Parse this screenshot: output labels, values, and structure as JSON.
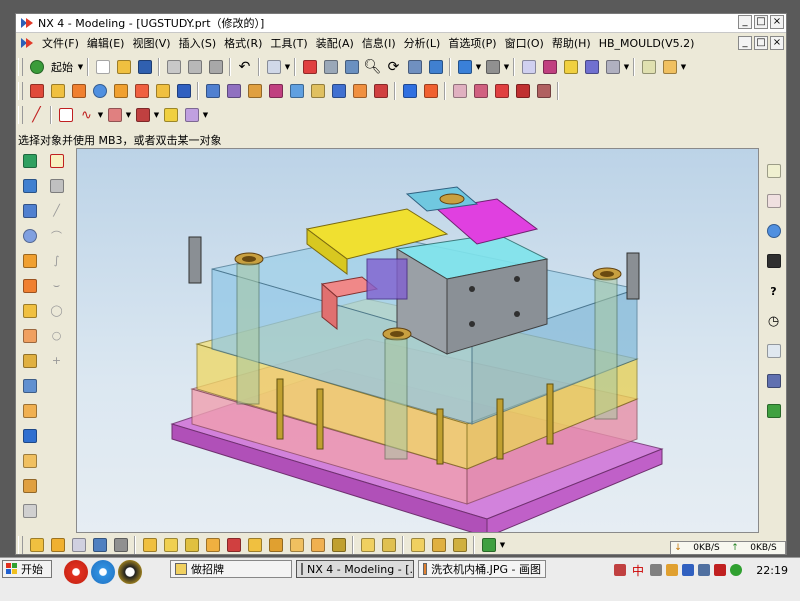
{
  "window": {
    "title": "NX 4 - Modeling - [UGSTUDY.prt（修改的）]",
    "min_label": "_",
    "max_label": "□",
    "close_label": "×"
  },
  "menu": {
    "items": [
      "文件(F)",
      "编辑(E)",
      "视图(V)",
      "插入(S)",
      "格式(R)",
      "工具(T)",
      "装配(A)",
      "信息(I)",
      "分析(L)",
      "首选项(P)",
      "窗口(O)",
      "帮助(H)",
      "HB_MOULD(V5.2)"
    ]
  },
  "toolbar1": {
    "start_label": "起始",
    "icons": [
      "new-icon",
      "open-icon",
      "save-icon",
      "cut-icon",
      "copy-icon",
      "paste-icon",
      "undo-icon",
      "selection-icon",
      "fit-icon",
      "zoom-window-icon",
      "zoom-icon",
      "rotate-icon",
      "pan-icon",
      "refresh-icon",
      "shaded-icon",
      "wireframe-icon",
      "wcs-icon",
      "datum-icon",
      "snap-icon",
      "filter-icon",
      "layer-icon",
      "measure-icon"
    ]
  },
  "toolbar2": {
    "icons": [
      "block-icon",
      "cylinder-icon",
      "cone-icon",
      "sphere-icon",
      "extrude-icon",
      "revolve-icon",
      "sweep-icon",
      "hole-icon",
      "boss-icon",
      "pocket-icon",
      "pad-icon",
      "slot-icon",
      "groove-icon",
      "thread-icon",
      "blend-icon",
      "chamfer-icon",
      "shell-icon",
      "draft-icon",
      "trim-icon",
      "split-icon",
      "offset-icon",
      "curve-icon",
      "spline-icon",
      "mirror-icon"
    ]
  },
  "toolbar3": {
    "icons": [
      "line-icon",
      "arc-icon",
      "point-icon",
      "plane-icon",
      "axis-icon",
      "sketch-icon",
      "project-icon",
      "intersect-icon",
      "bridge-icon",
      "fillet-curve-icon"
    ]
  },
  "status": {
    "prompt": "选择对象并使用 MB3，或者双击某一对象"
  },
  "netmon": {
    "down": "0KB/S",
    "up": "0KB/S"
  },
  "taskbar": {
    "start_label": "开始",
    "buttons": [
      "做招牌",
      "NX 4 - Modeling - [...",
      "洗衣机内桶.JPG - 画图"
    ],
    "ime": "中",
    "clock": "22:19"
  },
  "colors": {
    "viewport_top": "#bcd3e7",
    "mold_blue": "#8ec6e6",
    "mold_yellow": "#f5e05a",
    "mold_magenta": "#e060e0",
    "mold_cyan": "#5fe0e8",
    "mold_pink": "#f0a0a0",
    "mold_purple": "#c080d0",
    "mold_gray": "#8a8f94"
  }
}
